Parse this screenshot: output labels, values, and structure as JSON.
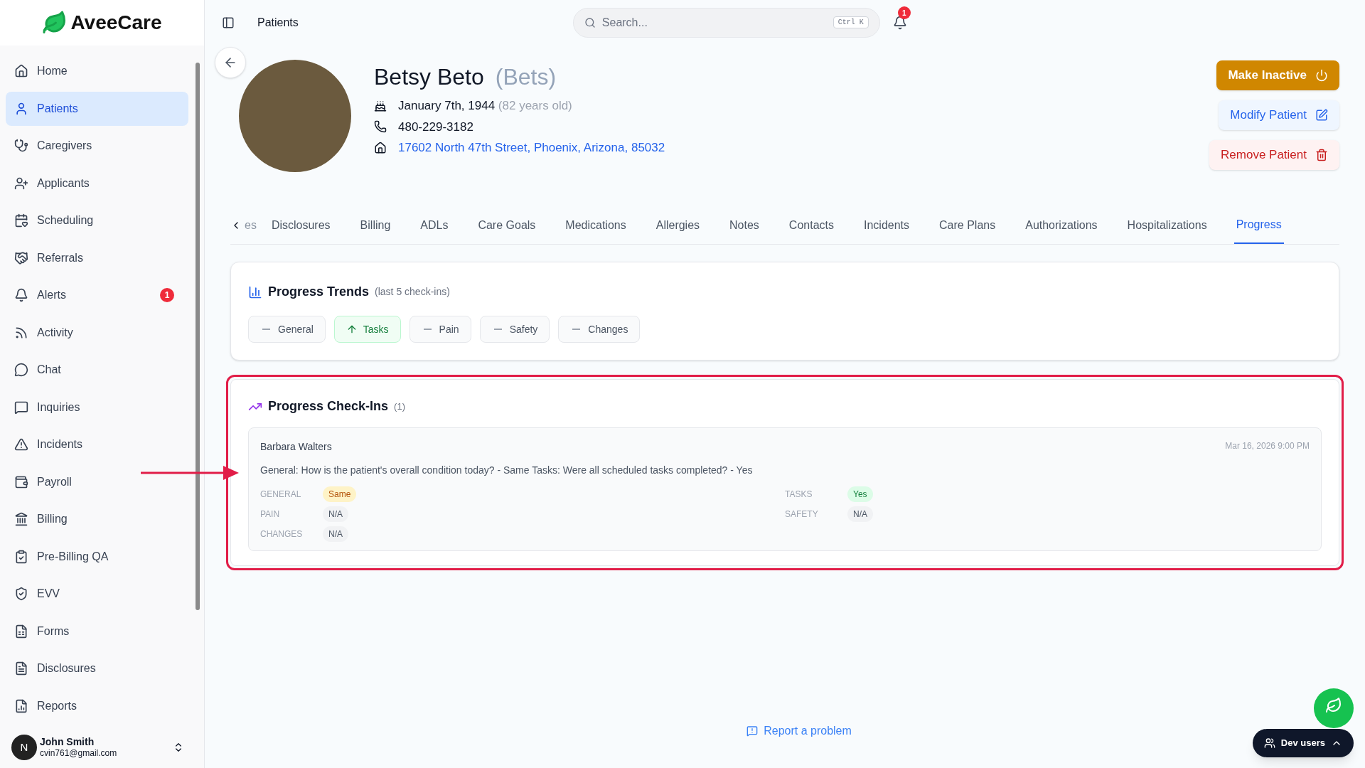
{
  "sidebar": {
    "logo": "AveeCare",
    "items": [
      {
        "label": "Home",
        "selected": false
      },
      {
        "label": "Patients",
        "selected": true
      },
      {
        "label": "Caregivers",
        "selected": false
      },
      {
        "label": "Applicants",
        "selected": false
      },
      {
        "label": "Scheduling",
        "selected": false
      },
      {
        "label": "Referrals",
        "selected": false
      },
      {
        "label": "Alerts",
        "selected": false,
        "badge": "1"
      },
      {
        "label": "Activity",
        "selected": false
      },
      {
        "label": "Chat",
        "selected": false
      },
      {
        "label": "Inquiries",
        "selected": false
      },
      {
        "label": "Incidents",
        "selected": false
      },
      {
        "label": "Payroll",
        "selected": false
      },
      {
        "label": "Billing",
        "selected": false
      },
      {
        "label": "Pre-Billing QA",
        "selected": false
      },
      {
        "label": "EVV",
        "selected": false
      },
      {
        "label": "Forms",
        "selected": false
      },
      {
        "label": "Disclosures",
        "selected": false
      },
      {
        "label": "Reports",
        "selected": false
      }
    ],
    "user": {
      "initial": "N",
      "name": "John Smith",
      "email": "cvin761@gmail.com"
    }
  },
  "header": {
    "breadcrumb": "Patients",
    "search": {
      "placeholder": "Search...",
      "shortcut": "Ctrl K"
    },
    "notifications": "1"
  },
  "patient": {
    "name": "Betsy Beto",
    "nickname": "(Bets)",
    "birth_date": "January 7th, 1944",
    "age": "(82 years old)",
    "phone": "480-229-3182",
    "address": "17602 North 47th Street, Phoenix, Arizona, 85032",
    "actions": [
      {
        "label": "Make Inactive",
        "kind": "warning"
      },
      {
        "label": "Modify Patient",
        "kind": "edit"
      },
      {
        "label": "Remove Patient",
        "kind": "danger"
      }
    ]
  },
  "tabs": [
    {
      "label": "es",
      "selected": false
    },
    {
      "label": "Disclosures",
      "selected": false
    },
    {
      "label": "Billing",
      "selected": false
    },
    {
      "label": "ADLs",
      "selected": false
    },
    {
      "label": "Care Goals",
      "selected": false
    },
    {
      "label": "Medications",
      "selected": false
    },
    {
      "label": "Allergies",
      "selected": false
    },
    {
      "label": "Notes",
      "selected": false
    },
    {
      "label": "Contacts",
      "selected": false
    },
    {
      "label": "Incidents",
      "selected": false
    },
    {
      "label": "Care Plans",
      "selected": false
    },
    {
      "label": "Authorizations",
      "selected": false
    },
    {
      "label": "Hospitalizations",
      "selected": false
    },
    {
      "label": "Progress",
      "selected": true
    }
  ],
  "progress_trends": {
    "title": "Progress Trends",
    "subtitle": "(last 5 check-ins)",
    "chips": [
      {
        "label": "General",
        "kind": "flat"
      },
      {
        "label": "Tasks",
        "kind": "up"
      },
      {
        "label": "Pain",
        "kind": "flat"
      },
      {
        "label": "Safety",
        "kind": "flat"
      },
      {
        "label": "Changes",
        "kind": "flat"
      }
    ]
  },
  "progress_checkins": {
    "title": "Progress Check-Ins",
    "count": "(1)",
    "entries": [
      {
        "author": "Barbara Walters",
        "timestamp": "Mar 16, 2026 9:00 PM",
        "summary": "General: How is the patient's overall condition today? - Same Tasks: Were all scheduled tasks completed? - Yes",
        "fields": [
          {
            "label": "GENERAL",
            "value": "Same",
            "kind": "warning"
          },
          {
            "label": "TASKS",
            "value": "Yes",
            "kind": "success"
          },
          {
            "label": "PAIN",
            "value": "N/A",
            "kind": "neutral"
          },
          {
            "label": "SAFETY",
            "value": "N/A",
            "kind": "neutral"
          },
          {
            "label": "CHANGES",
            "value": "N/A",
            "kind": "neutral"
          }
        ]
      }
    ]
  },
  "footer": {
    "report_link": "Report a problem",
    "dev_users": "Dev users"
  }
}
